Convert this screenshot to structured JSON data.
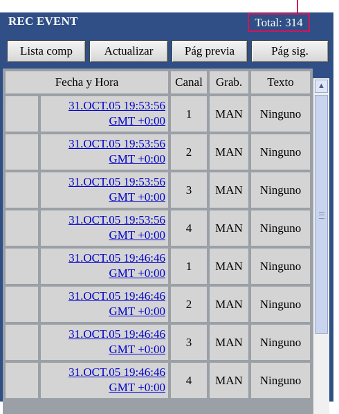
{
  "header": {
    "title": "REC EVENT",
    "total": "Total: 314"
  },
  "toolbar": {
    "lista_comp": "Lista comp",
    "actualizar": "Actualizar",
    "pag_previa": "Pág previa",
    "pag_sig": "Pág sig."
  },
  "table": {
    "columns": [
      "Fecha y Hora",
      "Canal",
      "Grab.",
      "Texto"
    ],
    "rows": [
      {
        "date": "31.OCT.05  19:53:56",
        "tz": "GMT +0:00",
        "canal": "1",
        "grab": "MAN",
        "texto": "Ninguno"
      },
      {
        "date": "31.OCT.05  19:53:56",
        "tz": "GMT +0:00",
        "canal": "2",
        "grab": "MAN",
        "texto": "Ninguno"
      },
      {
        "date": "31.OCT.05  19:53:56",
        "tz": "GMT +0:00",
        "canal": "3",
        "grab": "MAN",
        "texto": "Ninguno"
      },
      {
        "date": "31.OCT.05  19:53:56",
        "tz": "GMT +0:00",
        "canal": "4",
        "grab": "MAN",
        "texto": "Ninguno"
      },
      {
        "date": "31.OCT.05  19:46:46",
        "tz": "GMT +0:00",
        "canal": "1",
        "grab": "MAN",
        "texto": "Ninguno"
      },
      {
        "date": "31.OCT.05  19:46:46",
        "tz": "GMT +0:00",
        "canal": "2",
        "grab": "MAN",
        "texto": "Ninguno"
      },
      {
        "date": "31.OCT.05  19:46:46",
        "tz": "GMT +0:00",
        "canal": "3",
        "grab": "MAN",
        "texto": "Ninguno"
      },
      {
        "date": "31.OCT.05  19:46:46",
        "tz": "GMT +0:00",
        "canal": "4",
        "grab": "MAN",
        "texto": "Ninguno"
      }
    ]
  },
  "colors": {
    "title_bar": "#2f4f86",
    "highlight": "#d4145a",
    "link": "#0000cc"
  }
}
